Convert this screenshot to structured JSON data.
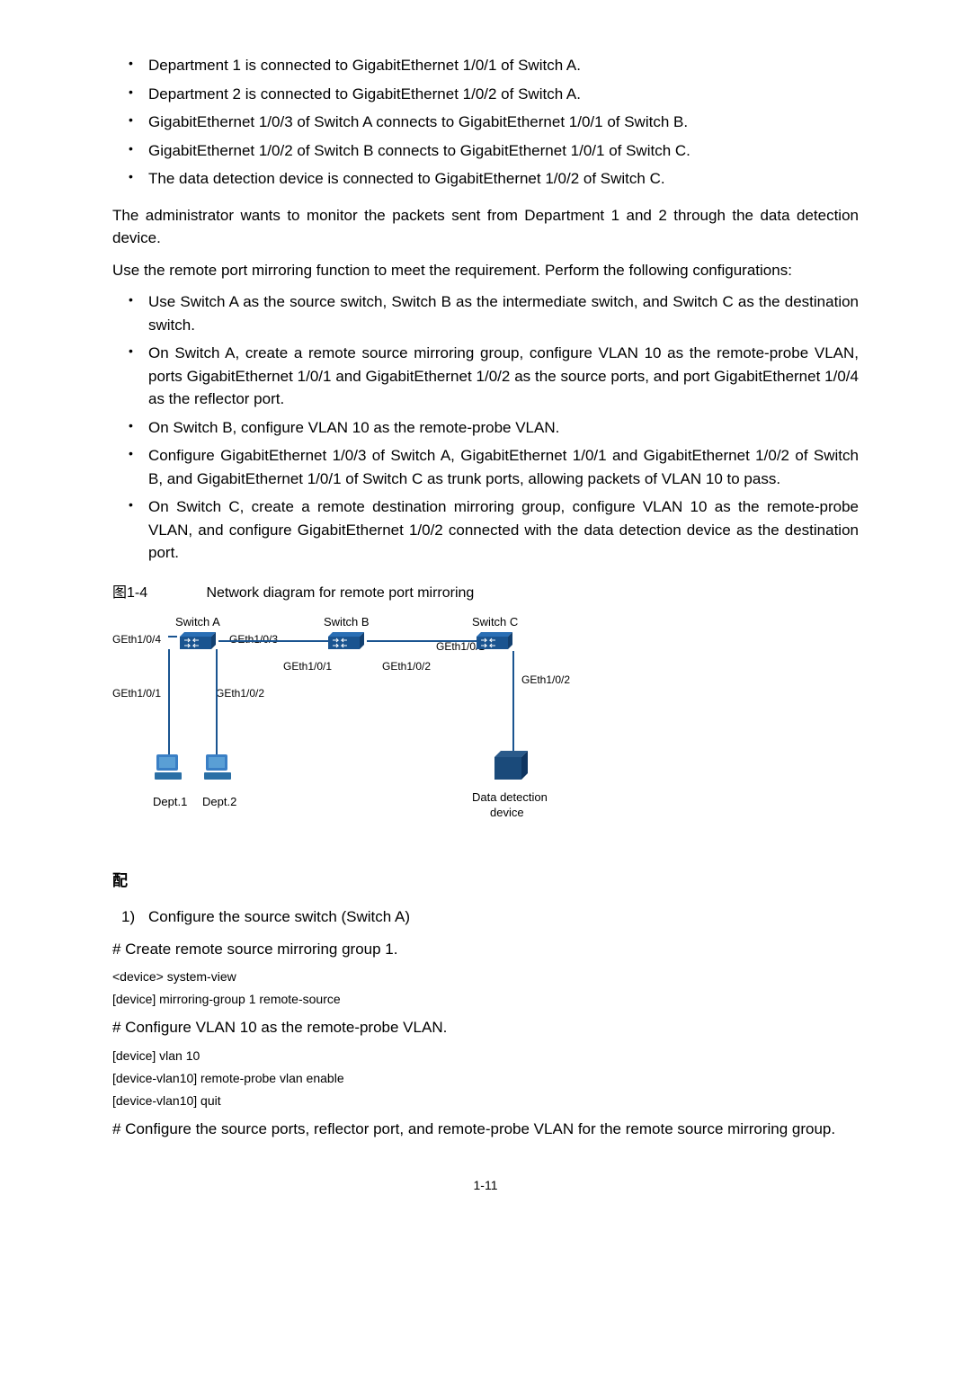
{
  "bullets1": [
    "Department 1 is connected to GigabitEthernet 1/0/1 of Switch A.",
    "Department 2 is connected to GigabitEthernet 1/0/2 of Switch A.",
    "GigabitEthernet 1/0/3 of Switch A connects to GigabitEthernet 1/0/1 of Switch B.",
    "GigabitEthernet 1/0/2 of Switch B connects to GigabitEthernet 1/0/1 of Switch C.",
    "The data detection device is connected to GigabitEthernet 1/0/2 of Switch C."
  ],
  "para1": "The administrator wants to monitor the packets sent from Department 1 and 2 through the data detection device.",
  "para2": "Use the remote port mirroring function to meet the requirement. Perform the following configurations:",
  "bullets2": [
    "Use Switch A as the source switch, Switch B as the intermediate switch, and Switch C as the destination switch.",
    "On Switch A, create a remote source mirroring group, configure VLAN 10 as the remote-probe VLAN, ports GigabitEthernet 1/0/1 and GigabitEthernet 1/0/2 as the source ports, and port GigabitEthernet 1/0/4 as the reflector port.",
    "On Switch B, configure VLAN 10 as the remote-probe VLAN.",
    "Configure GigabitEthernet 1/0/3 of Switch A, GigabitEthernet 1/0/1 and GigabitEthernet 1/0/2 of Switch B, and GigabitEthernet 1/0/1 of Switch C as trunk ports, allowing packets of VLAN 10 to pass.",
    "On Switch C, create a remote destination mirroring group, configure VLAN 10 as the remote-probe VLAN, and configure GigabitEthernet 1/0/2 connected with the data detection device as the destination port."
  ],
  "figure": {
    "num": "图1-4",
    "title": "Network diagram for remote port mirroring"
  },
  "diagram": {
    "switchA": "Switch A",
    "switchB": "Switch B",
    "switchC": "Switch C",
    "ge104": "GEth1/0/4",
    "ge103": "GEth1/0/3",
    "ge101a": "GEth1/0/1",
    "ge102a": "GEth1/0/2",
    "ge101b": "GEth1/0/1",
    "ge102b": "GEth1/0/2",
    "ge101c": "GEth1/0/1",
    "ge102c": "GEth1/0/2",
    "dept1": "Dept.1",
    "dept2": "Dept.2",
    "datadev": "Data detection",
    "datadev2": "device"
  },
  "procStub": "配",
  "step1": "Configure the source switch (Switch A)",
  "desc1": "# Create remote source mirroring group 1.",
  "cli1": "<device> system-view",
  "cli2": "[device] mirroring-group 1 remote-source",
  "desc2": "# Configure VLAN 10 as the remote-probe VLAN.",
  "cli3": "[device] vlan 10",
  "cli4": "[device-vlan10] remote-probe vlan enable",
  "cli5": "[device-vlan10] quit",
  "desc3": "# Configure the source ports, reflector port, and remote-probe VLAN for the remote source mirroring group.",
  "pageNum": "1-11"
}
